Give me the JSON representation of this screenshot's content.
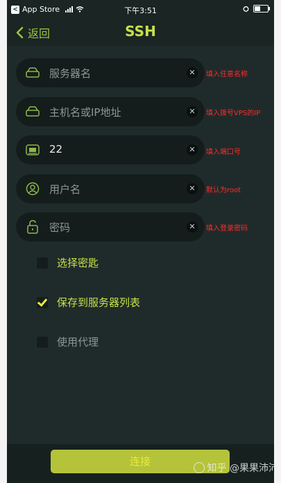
{
  "status_bar": {
    "back_app": "App Store",
    "time": "下午3:51"
  },
  "nav": {
    "back_label": "返回",
    "title": "SSH"
  },
  "fields": [
    {
      "icon": "server-icon",
      "text": "服务器名",
      "is_value": false,
      "annotation": "填入任意名称"
    },
    {
      "icon": "server-icon",
      "text": "主机名或IP地址",
      "is_value": false,
      "annotation": "填入拨号VPS的IP"
    },
    {
      "icon": "port-icon",
      "text": "22",
      "is_value": true,
      "annotation": "填入端口号"
    },
    {
      "icon": "user-icon",
      "text": "用户名",
      "is_value": false,
      "annotation": "默认为root"
    },
    {
      "icon": "lock-icon",
      "text": "密码",
      "is_value": false,
      "annotation": "填入登录密码"
    }
  ],
  "options": [
    {
      "label": "选择密匙",
      "checked": false
    },
    {
      "label": "保存到服务器列表",
      "checked": true
    },
    {
      "label": "使用代理",
      "checked": false
    }
  ],
  "connect_label": "连接",
  "watermark": "知乎 @果果沛沛",
  "colors": {
    "background": "#1f2b2a",
    "accent": "#c8e04a",
    "annotation": "#ff2b2b",
    "button": "#b5c33a"
  }
}
